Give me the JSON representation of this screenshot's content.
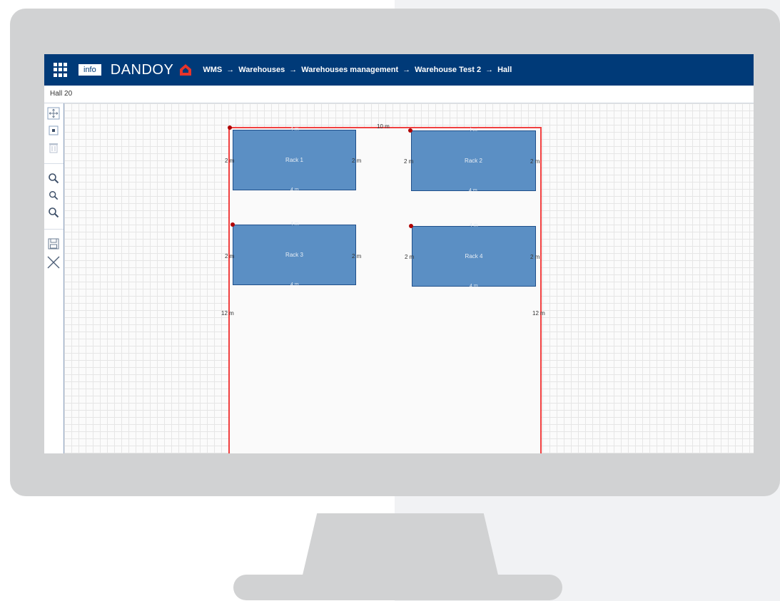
{
  "header": {
    "info_label": "info",
    "brand": "DANDOY",
    "breadcrumbs": [
      "WMS",
      "Warehouses",
      "Warehouses management",
      "Warehouse Test 2",
      "Hall"
    ],
    "separator": "→"
  },
  "subheader": {
    "title": "Hall 20"
  },
  "toolbar": {
    "tools": [
      "move-icon",
      "select-icon",
      "delete-icon",
      "zoom-in-icon",
      "zoom-out-icon",
      "zoom-reset-icon",
      "save-icon",
      "close-icon"
    ]
  },
  "hall": {
    "width_label": "10 m",
    "height_left_label": "12 m",
    "height_right_label": "12 m",
    "border_color": "#f04040"
  },
  "racks": [
    {
      "label": "Rack 1",
      "top_dim": "4 m",
      "bottom_dim": "4 m",
      "left_dim": "2 m",
      "right_dim": "2 m"
    },
    {
      "label": "Rack 2",
      "top_dim": "4 m",
      "bottom_dim": "4 m",
      "left_dim": "2 m",
      "right_dim": "2 m"
    },
    {
      "label": "Rack 3",
      "top_dim": "4 m",
      "bottom_dim": "4 m",
      "left_dim": "2 m",
      "right_dim": "2 m"
    },
    {
      "label": "Rack 4",
      "top_dim": "4 m",
      "bottom_dim": "4 m",
      "left_dim": "2 m",
      "right_dim": "2 m"
    }
  ],
  "colors": {
    "header": "#003a78",
    "rack_fill": "#5b8fc4",
    "rack_border": "#1f4f8a",
    "anchor": "#b00000"
  }
}
